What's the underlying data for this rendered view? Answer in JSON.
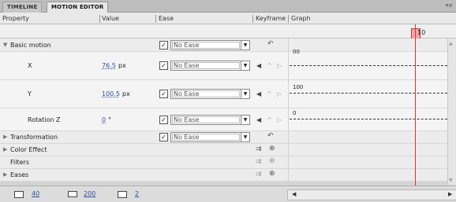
{
  "tabs": [
    {
      "label": "TIMELINE",
      "active": false
    },
    {
      "label": "MOTION EDITOR",
      "active": true
    }
  ],
  "header": {
    "property": "Property",
    "value": "Value",
    "ease": "Ease",
    "keyframe": "Keyframe",
    "graph": "Graph"
  },
  "playhead": {
    "frame": "10"
  },
  "rows": {
    "basic_motion": {
      "label": "Basic motion",
      "ease": "No Ease",
      "checked": "☑"
    },
    "x": {
      "label": "X",
      "value": "76.5",
      "unit": "px",
      "ease": "No Ease",
      "graph_label": "00"
    },
    "y": {
      "label": "Y",
      "value": "100.5",
      "unit": "px",
      "ease": "No Ease",
      "graph_label": "100"
    },
    "rotation_z": {
      "label": "Rotation Z",
      "value": "0",
      "unit": "°",
      "ease": "No Ease",
      "graph_label": "0"
    },
    "transformation": {
      "label": "Transformation",
      "ease": "No Ease"
    },
    "color_effect": {
      "label": "Color Effect"
    },
    "filters": {
      "label": "Filters"
    },
    "eases": {
      "label": "Eases"
    }
  },
  "footer": {
    "graph_size": "40",
    "expanded_graph_size": "200",
    "viewable_frames": "2"
  },
  "colors": {
    "playhead": "#dd3333",
    "link": "#2a4fa0",
    "background": "#d4d4d4"
  }
}
